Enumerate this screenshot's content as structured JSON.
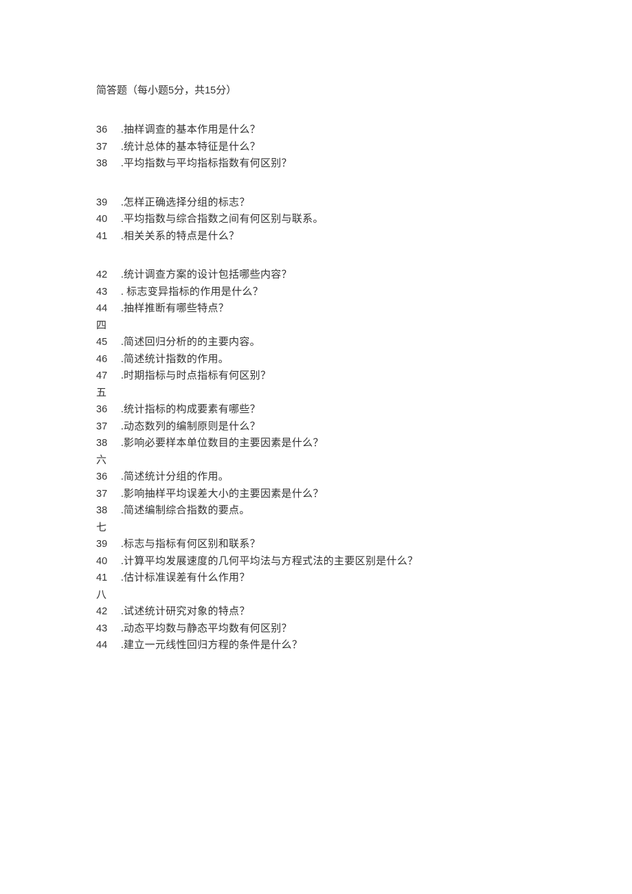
{
  "instruction": {
    "prefix": "简答题（每小题",
    "points_per": "5",
    "mid": "分，共",
    "points_total": "15",
    "suffix": "分）"
  },
  "groups": [
    {
      "label": "",
      "items": [
        {
          "num": "36",
          "text": ".抽样调查的基本作用是什么？"
        },
        {
          "num": "37",
          "text": ".统计总体的基本特征是什么？"
        },
        {
          "num": "38",
          "text": ".平均指数与平均指标指数有何区别？"
        }
      ]
    },
    {
      "label": "",
      "items": [
        {
          "num": "39",
          "text": ".怎样正确选择分组的标志？"
        },
        {
          "num": "40",
          "text": ".平均指数与综合指数之间有何区别与联系。"
        },
        {
          "num": "41",
          "text": ".相关关系的特点是什么？"
        }
      ]
    },
    {
      "label": "",
      "items": [
        {
          "num": "42",
          "text": ".统计调查方案的设计包括哪些内容？"
        },
        {
          "num": "43",
          "text": ". 标志变异指标的作用是什么？"
        },
        {
          "num": "44",
          "text": ".抽样推断有哪些特点？"
        }
      ]
    },
    {
      "label": "四",
      "items": [
        {
          "num": "45",
          "text": ".简述回归分析的的主要内容。"
        },
        {
          "num": "46",
          "text": ".简述统计指数的作用。"
        },
        {
          "num": "47",
          "text": ".时期指标与时点指标有何区别？"
        }
      ]
    },
    {
      "label": "五",
      "items": [
        {
          "num": "36",
          "text": ".统计指标的构成要素有哪些？"
        },
        {
          "num": "37",
          "text": ".动态数列的编制原则是什么？"
        },
        {
          "num": "38",
          "text": ".影响必要样本单位数目的主要因素是什么？"
        }
      ]
    },
    {
      "label": "六",
      "items": [
        {
          "num": "36",
          "text": ".简述统计分组的作用。"
        },
        {
          "num": "37",
          "text": ".影响抽样平均误差大小的主要因素是什么？"
        },
        {
          "num": "38",
          "text": ".简述编制综合指数的要点。"
        }
      ]
    },
    {
      "label": "七",
      "items": [
        {
          "num": "39",
          "text": ".标志与指标有何区别和联系？"
        },
        {
          "num": "40",
          "text": ".计算平均发展速度的几何平均法与方程式法的主要区别是什么？"
        },
        {
          "num": "41",
          "text": ".估计标准误差有什么作用？"
        }
      ]
    },
    {
      "label": "八",
      "items": [
        {
          "num": "42",
          "text": ".试述统计研究对象的特点？"
        },
        {
          "num": "43",
          "text": ".动态平均数与静态平均数有何区别？"
        },
        {
          "num": "44",
          "text": ".建立一元线性回归方程的条件是什么？"
        }
      ]
    }
  ]
}
